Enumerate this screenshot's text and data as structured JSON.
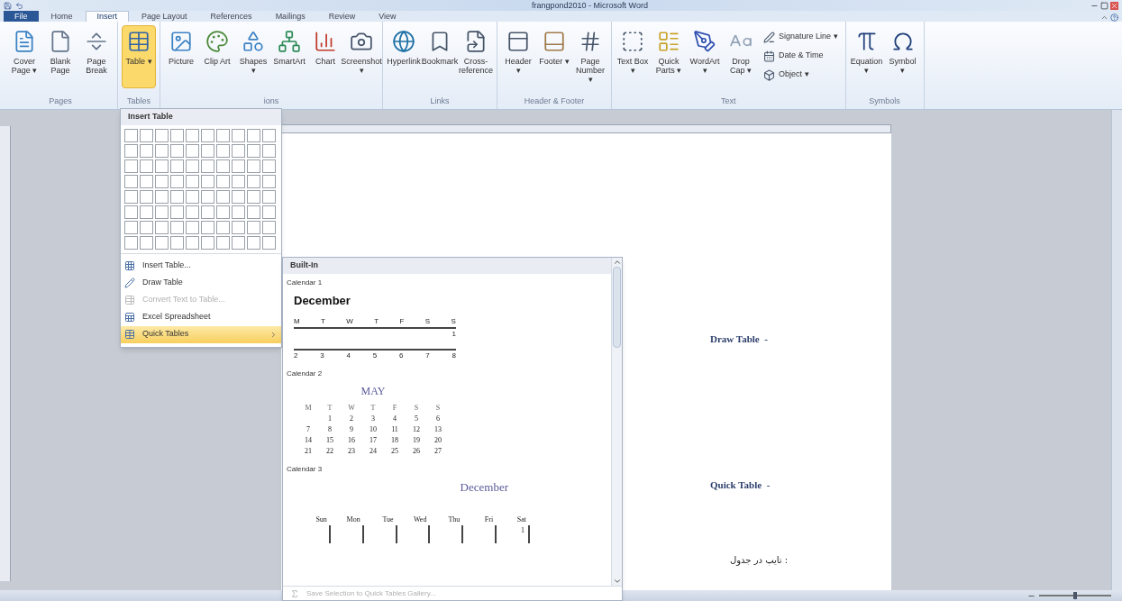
{
  "window": {
    "title": "frangpond2010 - Microsoft Word"
  },
  "tabs": [
    {
      "label": "File",
      "kind": "file",
      "selected": false
    },
    {
      "label": "Home",
      "kind": "tab",
      "selected": false
    },
    {
      "label": "Insert",
      "kind": "tab",
      "selected": true
    },
    {
      "label": "Page Layout",
      "kind": "tab",
      "selected": false
    },
    {
      "label": "References",
      "kind": "tab",
      "selected": false
    },
    {
      "label": "Mailings",
      "kind": "tab",
      "selected": false
    },
    {
      "label": "Review",
      "kind": "tab",
      "selected": false
    },
    {
      "label": "View",
      "kind": "tab",
      "selected": false
    }
  ],
  "ribbon": {
    "groups": [
      {
        "label": "Pages",
        "buttons": [
          {
            "label": "Cover Page ▾",
            "kind": "large",
            "selected": false
          },
          {
            "label": "Blank Page",
            "kind": "large",
            "selected": false
          },
          {
            "label": "Page Break",
            "kind": "large",
            "selected": false
          }
        ]
      },
      {
        "label": "Tables",
        "buttons": [
          {
            "label": "Table ▾",
            "kind": "large",
            "selected": true
          }
        ]
      },
      {
        "label": "ions",
        "buttons": [
          {
            "label": "Picture",
            "kind": "large",
            "selected": false
          },
          {
            "label": "Clip Art",
            "kind": "large",
            "selected": false
          },
          {
            "label": "Shapes ▾",
            "kind": "large",
            "selected": false
          },
          {
            "label": "SmartArt",
            "kind": "large",
            "selected": false
          },
          {
            "label": "Chart",
            "kind": "large",
            "selected": false
          },
          {
            "label": "Screenshot ▾",
            "kind": "large",
            "selected": false
          }
        ]
      },
      {
        "label": "Links",
        "buttons": [
          {
            "label": "Hyperlink",
            "kind": "large",
            "selected": false
          },
          {
            "label": "Bookmark",
            "kind": "large",
            "selected": false
          },
          {
            "label": "Cross-reference",
            "kind": "large",
            "selected": false
          }
        ]
      },
      {
        "label": "Header & Footer",
        "buttons": [
          {
            "label": "Header ▾",
            "kind": "large",
            "selected": false
          },
          {
            "label": "Footer ▾",
            "kind": "large",
            "selected": false
          },
          {
            "label": "Page Number ▾",
            "kind": "large",
            "selected": false
          }
        ]
      },
      {
        "label": "Text",
        "buttons": [
          {
            "label": "Text Box ▾",
            "kind": "large",
            "selected": false
          },
          {
            "label": "Quick Parts ▾",
            "kind": "large",
            "selected": false
          },
          {
            "label": "WordArt ▾",
            "kind": "large",
            "selected": false
          },
          {
            "label": "Drop Cap ▾",
            "kind": "large",
            "selected": false
          },
          {
            "label": "Signature Line ▾",
            "kind": "small",
            "selected": false
          },
          {
            "label": "Date & Time",
            "kind": "small",
            "selected": false
          },
          {
            "label": "Object ▾",
            "kind": "small",
            "selected": false
          }
        ]
      },
      {
        "label": "Symbols",
        "buttons": [
          {
            "label": "Equation ▾",
            "kind": "large",
            "selected": false
          },
          {
            "label": "Symbol ▾",
            "kind": "large",
            "selected": false
          }
        ]
      }
    ]
  },
  "table_menu": {
    "title": "Insert Table",
    "items": [
      {
        "label": "Insert Table...",
        "disabled": false,
        "highlighted": false,
        "submenu": false
      },
      {
        "label": "Draw Table",
        "disabled": false,
        "highlighted": false,
        "submenu": false
      },
      {
        "label": "Convert Text to Table...",
        "disabled": true,
        "highlighted": false,
        "submenu": false
      },
      {
        "label": "Excel Spreadsheet",
        "disabled": false,
        "highlighted": false,
        "submenu": false
      },
      {
        "label": "Quick Tables",
        "disabled": false,
        "highlighted": true,
        "submenu": true
      }
    ]
  },
  "quick_tables": {
    "header": "Built-In",
    "items": [
      {
        "kind": "calendar1",
        "label": "Calendar 1",
        "month": "December",
        "days": [
          "M",
          "T",
          "W",
          "T",
          "F",
          "S",
          "S"
        ],
        "first_row": [
          "1"
        ],
        "second_row": [
          "2",
          "3",
          "4",
          "5",
          "6",
          "7",
          "8"
        ]
      },
      {
        "kind": "calendar2",
        "label": "Calendar 2",
        "month": "MAY",
        "days": [
          "M",
          "T",
          "W",
          "T",
          "F",
          "S",
          "S"
        ],
        "weeks": [
          [
            "1",
            "2",
            "3",
            "4",
            "5",
            "6"
          ],
          [
            "7",
            "8",
            "9",
            "10",
            "11",
            "12",
            "13"
          ],
          [
            "14",
            "15",
            "16",
            "17",
            "18",
            "19",
            "20"
          ],
          [
            "21",
            "22",
            "23",
            "24",
            "25",
            "26",
            "27"
          ]
        ]
      },
      {
        "kind": "calendar3",
        "label": "Calendar 3",
        "month": "December",
        "days": [
          "Sun",
          "Mon",
          "Tue",
          "Wed",
          "Thu",
          "Fri",
          "Sat"
        ],
        "first_row": [
          "1"
        ]
      }
    ],
    "footer": {
      "label": "Save Selection to Quick Tables Gallery...",
      "disabled": true
    }
  },
  "status_bar": {
    "zoom": {
      "level": 0.5
    }
  },
  "document": {
    "lines": [
      {
        "kind": "heading",
        "text": "Draw Table  -"
      },
      {
        "kind": "heading",
        "text": "Quick Table  -"
      },
      {
        "kind": "rtl",
        "text": ": تایپ در جدول"
      }
    ]
  }
}
